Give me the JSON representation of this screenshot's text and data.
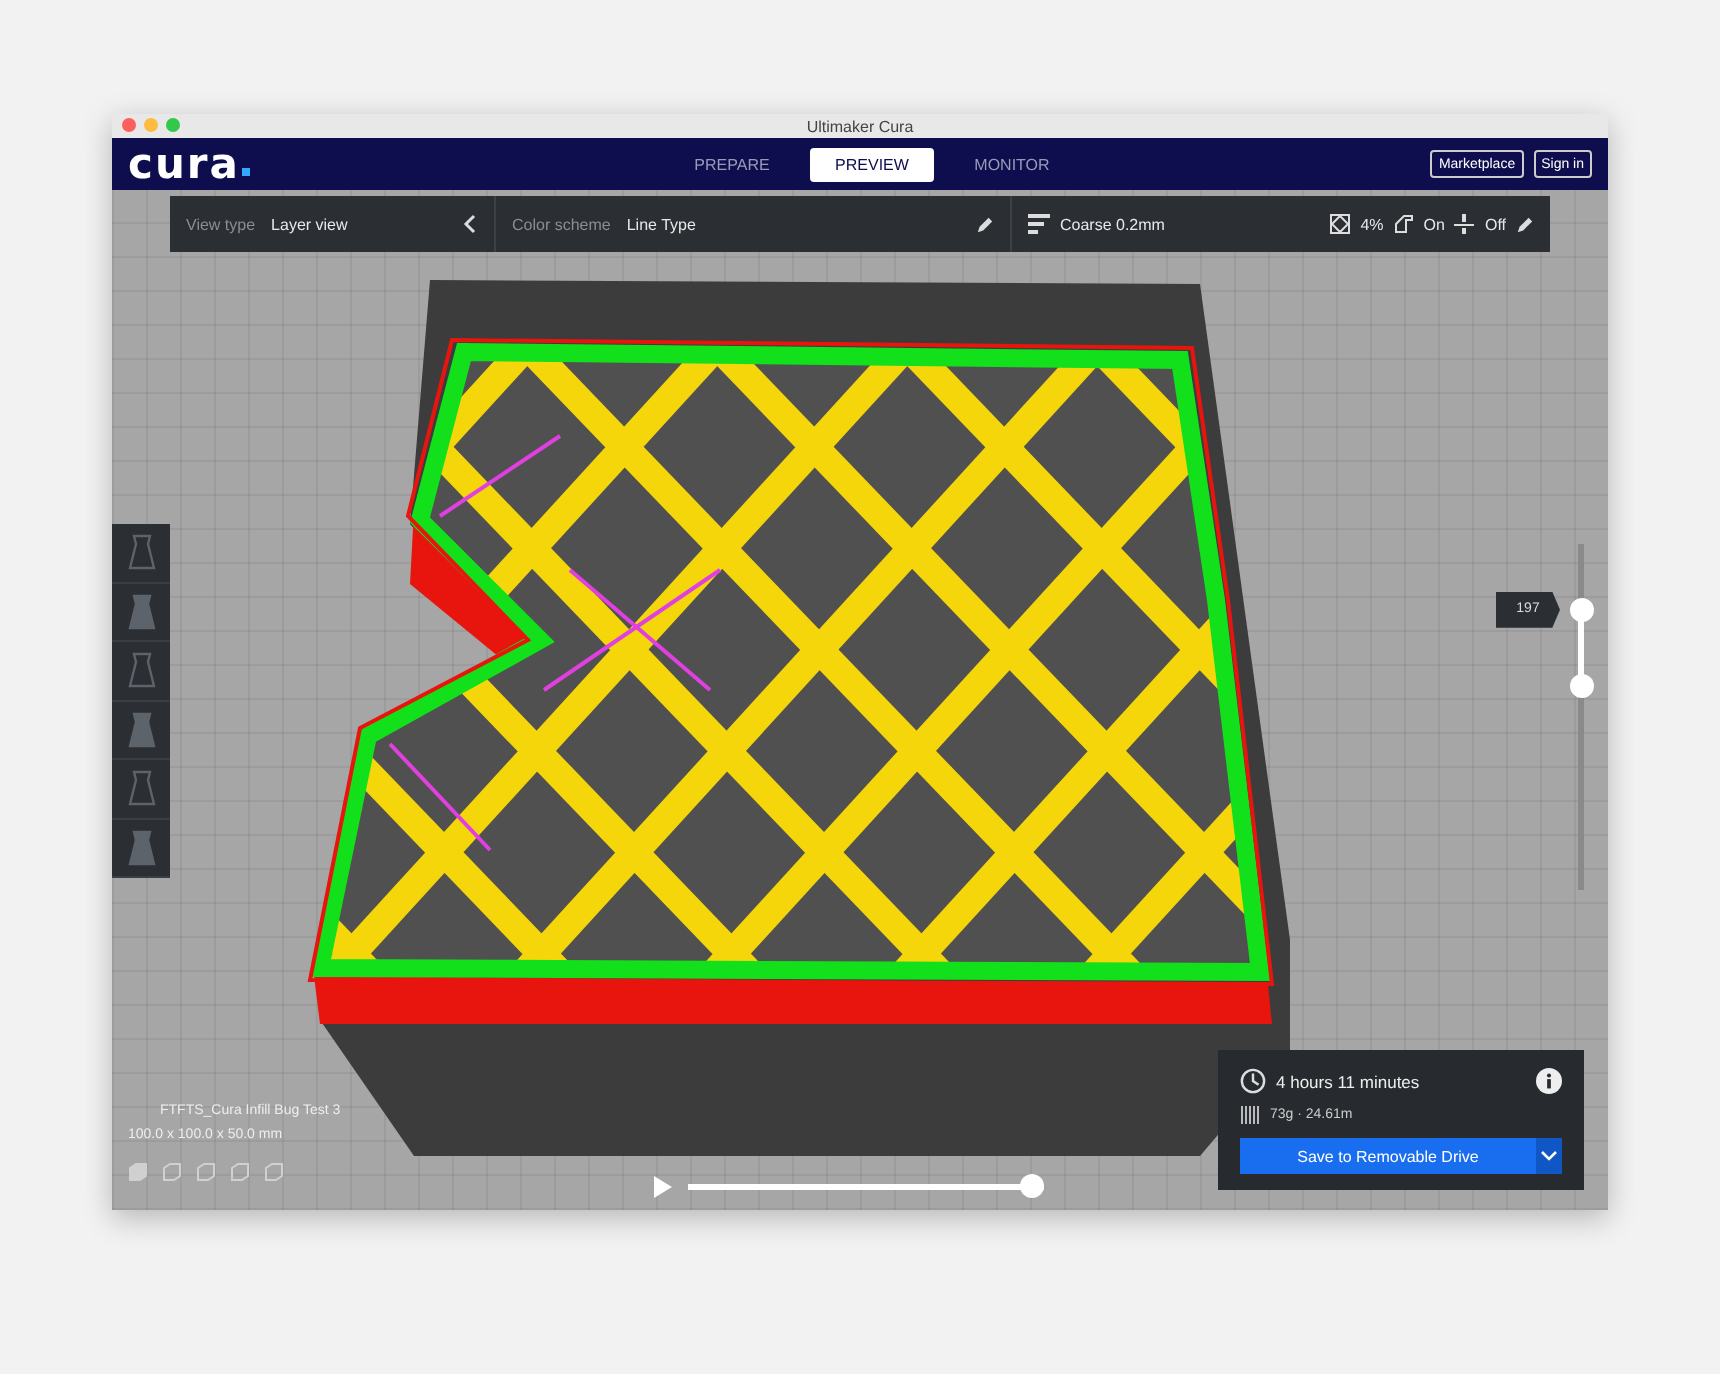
{
  "window": {
    "title": "Ultimaker Cura"
  },
  "header": {
    "logo": "cura",
    "tabs": [
      {
        "label": "PREPARE",
        "selected": false
      },
      {
        "label": "PREVIEW",
        "selected": true
      },
      {
        "label": "MONITOR",
        "selected": false
      }
    ],
    "buttons": [
      "Marketplace",
      "Sign in"
    ]
  },
  "toolbar": {
    "view_type": {
      "label": "View type",
      "value": "Layer view"
    },
    "color_scheme": {
      "label": "Color scheme",
      "value": "Line Type"
    },
    "profile": "Coarse 0.2mm",
    "infill": "4%",
    "support": "On",
    "adhesion": "Off"
  },
  "layer_slider": {
    "value": "197",
    "handles": [
      {
        "level": 0.81
      },
      {
        "level": 0.59
      }
    ]
  },
  "object": {
    "name": "FTFTS_Cura Infill Bug Test 3",
    "dimensions": "100.0 x 100.0 x 50.0 mm"
  },
  "playback": {
    "level": 1
  },
  "print_panel": {
    "time": "4 hours 11 minutes",
    "material": "73g · 24.61m",
    "button": "Save to Removable Drive"
  }
}
